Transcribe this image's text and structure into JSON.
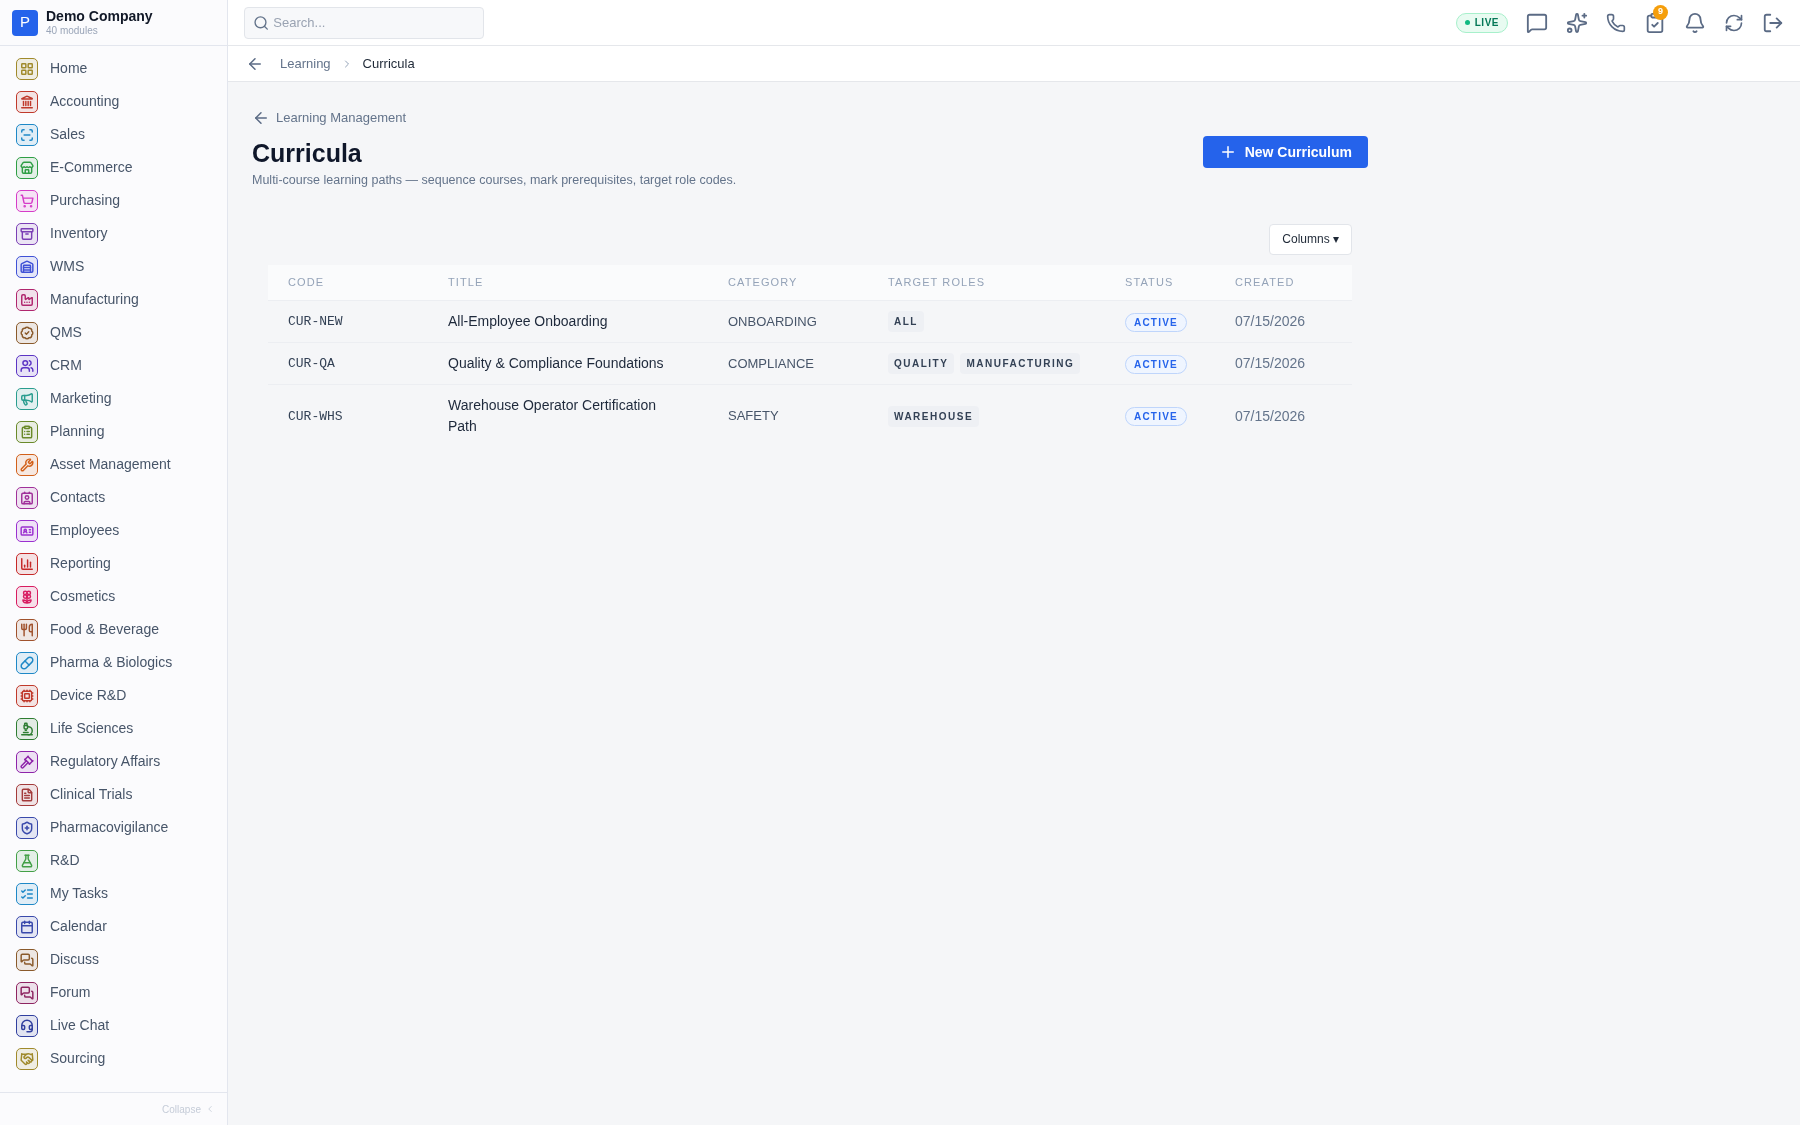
{
  "company": {
    "logo": "P",
    "name": "Demo Company",
    "subtitle": "40 modules"
  },
  "sidebar": {
    "items": [
      {
        "label": "Home",
        "color": "#a08a2c"
      },
      {
        "label": "Accounting",
        "color": "#c0392b"
      },
      {
        "label": "Sales",
        "color": "#1e88c7"
      },
      {
        "label": "E-Commerce",
        "color": "#2e9e44"
      },
      {
        "label": "Purchasing",
        "color": "#d63cc8"
      },
      {
        "label": "Inventory",
        "color": "#7b3fb5"
      },
      {
        "label": "WMS",
        "color": "#3f51d6"
      },
      {
        "label": "Manufacturing",
        "color": "#b0266e"
      },
      {
        "label": "QMS",
        "color": "#8a5a2b"
      },
      {
        "label": "CRM",
        "color": "#5b34c4"
      },
      {
        "label": "Marketing",
        "color": "#2a9d8f"
      },
      {
        "label": "Planning",
        "color": "#6a8a2a"
      },
      {
        "label": "Asset Management",
        "color": "#d2601a"
      },
      {
        "label": "Contacts",
        "color": "#a0309a"
      },
      {
        "label": "Employees",
        "color": "#9b30d0"
      },
      {
        "label": "Reporting",
        "color": "#c62828"
      },
      {
        "label": "Cosmetics",
        "color": "#d81b60"
      },
      {
        "label": "Food & Beverage",
        "color": "#a0522d"
      },
      {
        "label": "Pharma & Biologics",
        "color": "#1e88c7"
      },
      {
        "label": "Device R&D",
        "color": "#c0392b"
      },
      {
        "label": "Life Sciences",
        "color": "#2e7d32"
      },
      {
        "label": "Regulatory Affairs",
        "color": "#8e24aa"
      },
      {
        "label": "Clinical Trials",
        "color": "#a33a3a"
      },
      {
        "label": "Pharmacovigilance",
        "color": "#3949ab"
      },
      {
        "label": "R&D",
        "color": "#43a047"
      },
      {
        "label": "My Tasks",
        "color": "#1e88c7"
      },
      {
        "label": "Calendar",
        "color": "#3949ab"
      },
      {
        "label": "Discuss",
        "color": "#8a5a2b"
      },
      {
        "label": "Forum",
        "color": "#8e2461"
      },
      {
        "label": "Live Chat",
        "color": "#303f9f"
      },
      {
        "label": "Sourcing",
        "color": "#a08a2c"
      }
    ],
    "collapse": "Collapse"
  },
  "topbar": {
    "search": {
      "placeholder": "Search..."
    },
    "live": "LIVE",
    "notification_count": "9"
  },
  "breadcrumb": [
    "Learning",
    "Curricula"
  ],
  "page": {
    "back": "Learning Management",
    "title": "Curricula",
    "subtitle": "Multi-course learning paths — sequence courses, mark prerequisites, target role codes.",
    "new_button": "New Curriculum",
    "columns_button": "Columns ▾"
  },
  "table": {
    "columns": [
      "CODE",
      "TITLE",
      "CATEGORY",
      "TARGET ROLES",
      "STATUS",
      "CREATED"
    ],
    "rows": [
      {
        "code": "CUR-NEW",
        "title": "All-Employee Onboarding",
        "category": "ONBOARDING",
        "roles": [
          "ALL"
        ],
        "status": "ACTIVE",
        "created": "07/15/2026"
      },
      {
        "code": "CUR-QA",
        "title": "Quality & Compliance Foundations",
        "category": "COMPLIANCE",
        "roles": [
          "QUALITY",
          "MANUFACTURING"
        ],
        "status": "ACTIVE",
        "created": "07/15/2026"
      },
      {
        "code": "CUR-WHS",
        "title": "Warehouse Operator Certification Path",
        "category": "SAFETY",
        "roles": [
          "WAREHOUSE"
        ],
        "status": "ACTIVE",
        "created": "07/15/2026"
      }
    ]
  }
}
